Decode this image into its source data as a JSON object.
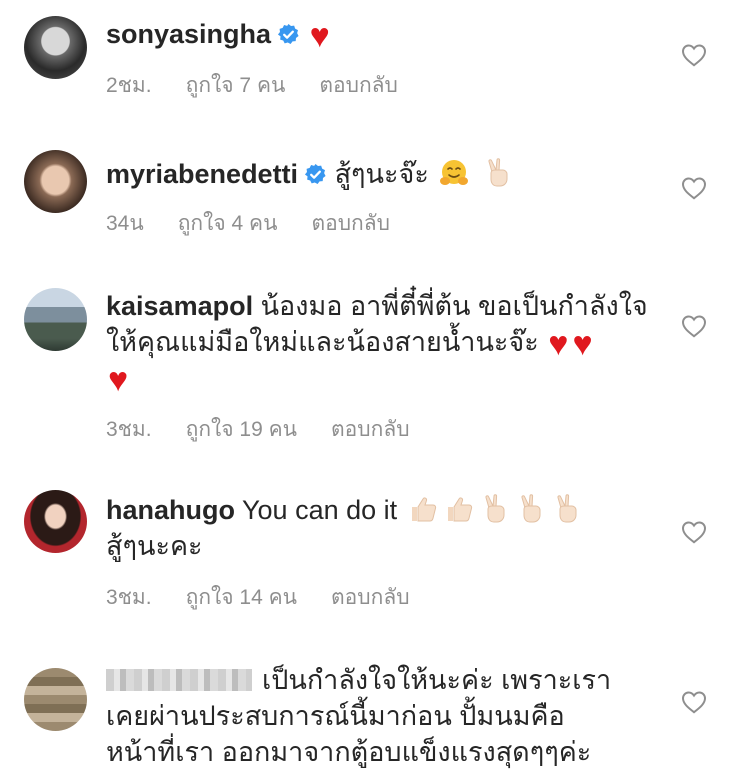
{
  "comments": [
    {
      "username": "sonyasingha",
      "verified": true,
      "text": "",
      "time": "2ชม.",
      "likes": "ถูกใจ 7 คน",
      "reply": "ตอบกลับ"
    },
    {
      "username": "myriabenedetti",
      "verified": true,
      "text": "สู้ๆนะจ๊ะ",
      "time": "34น",
      "likes": "ถูกใจ 4 คน",
      "reply": "ตอบกลับ"
    },
    {
      "username": "kaisamapol",
      "verified": false,
      "text": "น้องมอ อาพี่ตี๋พี่ต้น ขอเป็นกำลังใจให้คุณแม่มือใหม่และน้องสายน้ำนะจ๊ะ",
      "time": "3ชม.",
      "likes": "ถูกใจ 19 คน",
      "reply": "ตอบกลับ"
    },
    {
      "username": "hanahugo",
      "verified": false,
      "text": "You can do it",
      "text2": "สู้ๆนะคะ",
      "time": "3ชม.",
      "likes": "ถูกใจ 14 คน",
      "reply": "ตอบกลับ"
    },
    {
      "username": "",
      "verified": false,
      "text": "เป็นกำลังใจให้นะค่ะ เพราะเราเคยผ่านประสบการณ์นี้มาก่อน ปั้มนมคือหน้าที่เรา ออกมาจากตู้อบแข็งแรงสุดๆๆค่ะ"
    }
  ],
  "icons": {
    "like": "heart-outline-icon",
    "verified": "verified-badge-icon",
    "emoji_heart": "red-heart-emoji",
    "emoji_hug": "hugging-face-emoji",
    "emoji_thumbs": "thumbs-up-emoji",
    "emoji_victory": "victory-hand-emoji"
  },
  "colors": {
    "text": "#262626",
    "meta": "#8e8e8e",
    "verified": "#3897f0",
    "heart": "#e0181e"
  }
}
